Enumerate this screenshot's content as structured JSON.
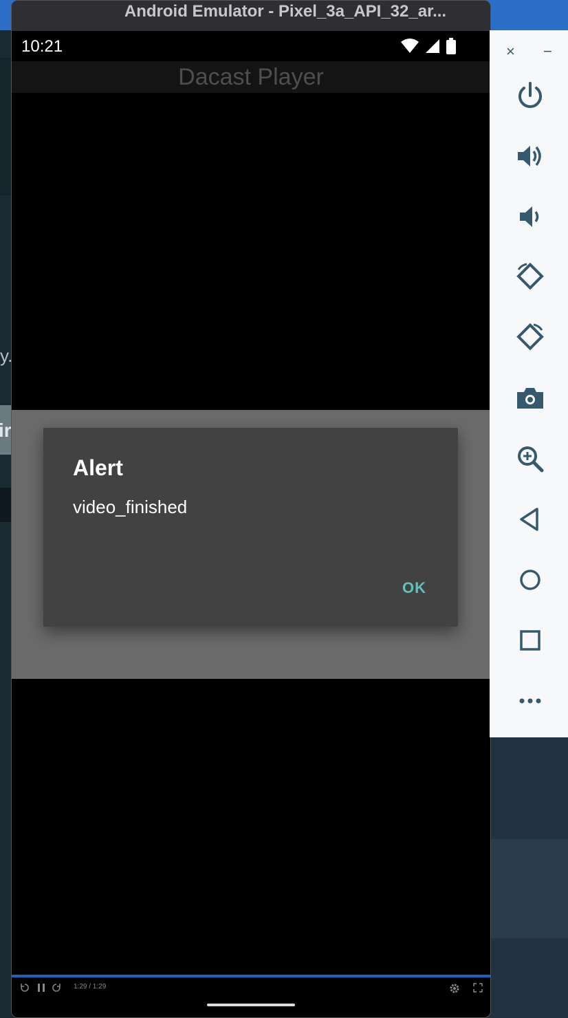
{
  "window": {
    "title": "Android Emulator - Pixel_3a_API_32_ar..."
  },
  "statusbar": {
    "time": "10:21"
  },
  "app": {
    "title": "Dacast Player"
  },
  "dialog": {
    "title": "Alert",
    "message": "video_finished",
    "ok_label": "OK"
  },
  "player": {
    "time": "1:29 / 1:29",
    "progress": 1.0
  },
  "desktop_fragments": {
    "left_text_1": "y.",
    "left_text_2": "ir"
  },
  "toolbar": {
    "close_glyph": "×",
    "minimize_glyph": "−",
    "buttons": [
      {
        "icon": "power-icon"
      },
      {
        "icon": "volume-up-icon"
      },
      {
        "icon": "volume-down-icon"
      },
      {
        "icon": "rotate-left-icon"
      },
      {
        "icon": "rotate-right-icon"
      },
      {
        "icon": "camera-icon"
      },
      {
        "icon": "zoom-icon"
      },
      {
        "icon": "back-icon"
      },
      {
        "icon": "home-icon"
      },
      {
        "icon": "overview-icon"
      },
      {
        "icon": "more-icon"
      }
    ]
  },
  "colors": {
    "accent": "#5ec2bd",
    "toolbar_icon": "#36596e",
    "progress": "#1565c0"
  }
}
